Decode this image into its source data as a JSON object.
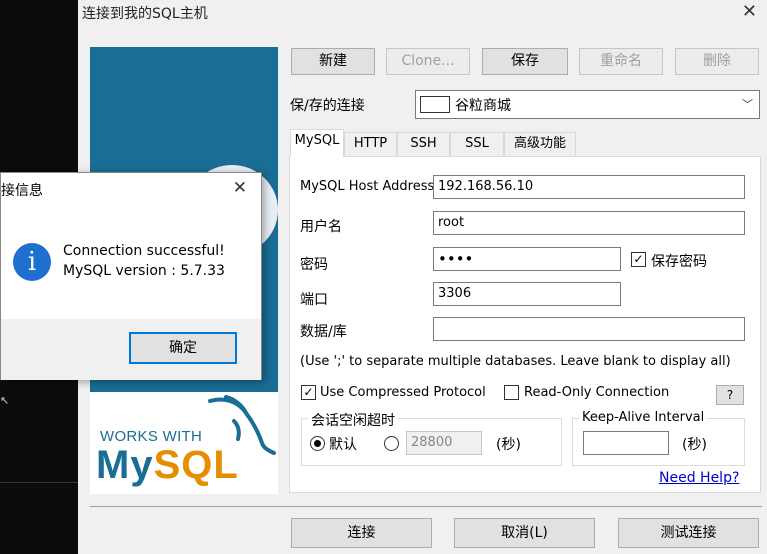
{
  "window": {
    "title": "连接到我的SQL主机"
  },
  "toolbar": {
    "new": "新建",
    "clone": "Clone...",
    "save": "保存",
    "rename": "重命名",
    "delete": "删除"
  },
  "saved_connection": {
    "label": "保/存的连接",
    "value": "谷粒商城"
  },
  "tabs": [
    "MySQL",
    "HTTP",
    "SSH",
    "SSL",
    "高级功能"
  ],
  "form": {
    "host_label": "MySQL Host Address",
    "host_value": "192.168.56.10",
    "user_label": "用户名",
    "user_value": "root",
    "password_label": "密码",
    "password_value": "••••",
    "save_password": "保存密码",
    "port_label": "端口",
    "port_value": "3306",
    "db_label": "数据/库",
    "db_value": "",
    "db_hint": "(Use ';' to separate multiple databases. Leave blank to display all)",
    "compressed": "Use Compressed Protocol",
    "readonly": "Read-Only Connection",
    "help_button": "?",
    "session_group": "会话空闲超时",
    "default_label": "默认",
    "timeout_value": "28800",
    "seconds": "(秒)",
    "keepalive_group": "Keep-Alive Interval",
    "keepalive_value": "",
    "need_help": "Need Help?"
  },
  "banner": {
    "works_with": "WORKS WITH",
    "logo_my": "My",
    "logo_sql": "SQL"
  },
  "buttons": {
    "connect": "连接",
    "cancel": "取消(L)",
    "test": "测试连接"
  },
  "dialog": {
    "title": "接信息",
    "close": "✕",
    "message_line1": "Connection successful!",
    "message_line2": "MySQL version : 5.7.33",
    "ok": "确定"
  },
  "desktop": {
    "arrow": "↖"
  },
  "colors": {
    "banner_blue": "#1a6d95",
    "mysql_orange": "#e48e00",
    "info_blue": "#1f6fcf",
    "link": "#0000cc"
  }
}
